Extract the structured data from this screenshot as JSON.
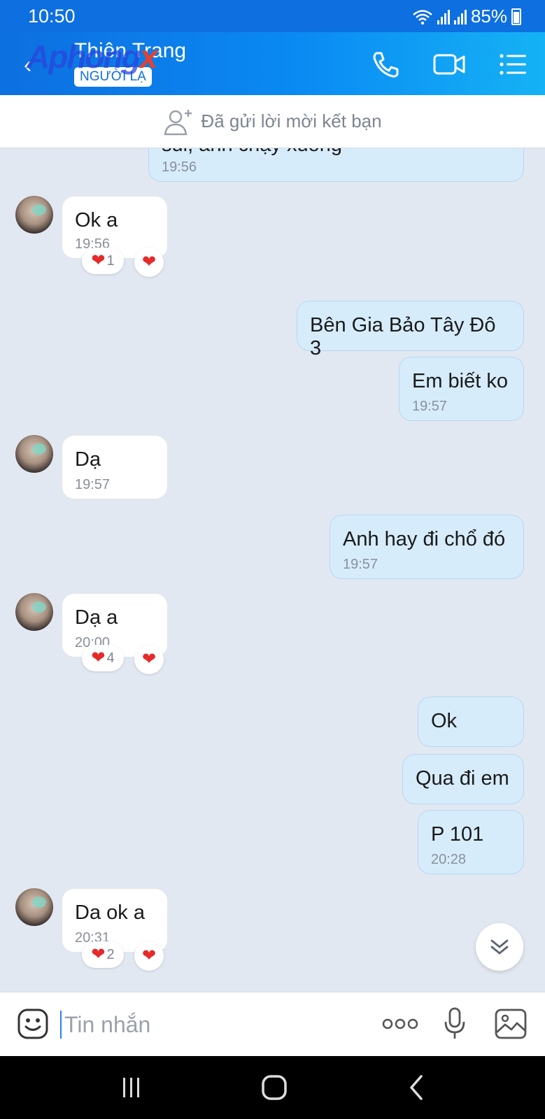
{
  "status_bar": {
    "time": "10:50",
    "battery": "85%"
  },
  "header": {
    "contact_name": "Thiên Trang",
    "stranger_badge": "NGƯỜI LẠ",
    "watermark": "Aphong",
    "watermark_x": "x"
  },
  "friend_request": {
    "text": "Đã gửi lời mời kết bạn"
  },
  "messages": [
    {
      "direction": "out",
      "text": "sui, anh chạy xuống",
      "time": "19:56"
    },
    {
      "direction": "in",
      "text": "Ok a",
      "time": "19:56",
      "reaction_count": "1"
    },
    {
      "direction": "out",
      "text": "Bên Gia Bảo Tây Đô 3",
      "time": ""
    },
    {
      "direction": "out",
      "text": "Em biết ko",
      "time": "19:57"
    },
    {
      "direction": "in",
      "text": "Dạ",
      "time": "19:57"
    },
    {
      "direction": "out",
      "text": "Anh hay đi chổ đó",
      "time": "19:57"
    },
    {
      "direction": "in",
      "text": "Dạ a",
      "time": "20:00",
      "reaction_count": "4"
    },
    {
      "direction": "out",
      "text": "Ok",
      "time": ""
    },
    {
      "direction": "out",
      "text": "Qua đi em",
      "time": ""
    },
    {
      "direction": "out",
      "text": "P 101",
      "time": "20:28"
    },
    {
      "direction": "in",
      "text": "Da ok a",
      "time": "20:31",
      "reaction_count": "2"
    }
  ],
  "input": {
    "placeholder": "Tin nhắn"
  },
  "colors": {
    "primary": "#0d6fe0",
    "outgoing_bubble": "#d6ecfb",
    "incoming_bubble": "#ffffff",
    "chat_background": "#e2e8f1",
    "heart": "#e52a2a"
  },
  "icons": [
    "wifi-icon",
    "signal-icon",
    "battery-icon",
    "back-arrow-icon",
    "phone-icon",
    "video-call-icon",
    "menu-icon",
    "add-friend-icon",
    "heart-icon",
    "scroll-down-icon",
    "sticker-icon",
    "more-icon",
    "mic-icon",
    "image-icon",
    "recent-apps-icon",
    "home-icon",
    "back-icon"
  ]
}
